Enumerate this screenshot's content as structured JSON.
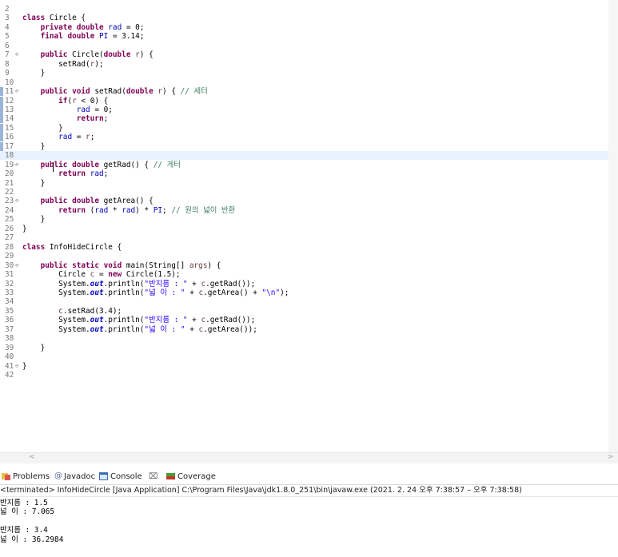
{
  "editor": {
    "lines": [
      {
        "n": "2",
        "parts": []
      },
      {
        "n": "3",
        "parts": [
          {
            "t": "class",
            "c": "kw"
          },
          {
            "t": " Circle {"
          }
        ]
      },
      {
        "n": "4",
        "parts": [
          {
            "t": "    "
          },
          {
            "t": "private",
            "c": "kw"
          },
          {
            "t": " "
          },
          {
            "t": "double",
            "c": "kw"
          },
          {
            "t": " "
          },
          {
            "t": "rad",
            "c": "fld"
          },
          {
            "t": " = 0;"
          }
        ]
      },
      {
        "n": "5",
        "parts": [
          {
            "t": "    "
          },
          {
            "t": "final",
            "c": "kw"
          },
          {
            "t": " "
          },
          {
            "t": "double",
            "c": "kw"
          },
          {
            "t": " "
          },
          {
            "t": "PI",
            "c": "fld"
          },
          {
            "t": " = 3.14;"
          }
        ]
      },
      {
        "n": "6",
        "parts": []
      },
      {
        "n": "7",
        "fold": true,
        "parts": [
          {
            "t": "    "
          },
          {
            "t": "public",
            "c": "kw"
          },
          {
            "t": " Circle("
          },
          {
            "t": "double",
            "c": "kw"
          },
          {
            "t": " "
          },
          {
            "t": "r",
            "c": "prm"
          },
          {
            "t": ") {"
          }
        ]
      },
      {
        "n": "8",
        "parts": [
          {
            "t": "        setRad("
          },
          {
            "t": "r",
            "c": "prm"
          },
          {
            "t": ");"
          }
        ]
      },
      {
        "n": "9",
        "parts": [
          {
            "t": "    }"
          }
        ]
      },
      {
        "n": "10",
        "parts": []
      },
      {
        "n": "11",
        "fold": true,
        "mark": true,
        "parts": [
          {
            "t": "    "
          },
          {
            "t": "public",
            "c": "kw"
          },
          {
            "t": " "
          },
          {
            "t": "void",
            "c": "kw"
          },
          {
            "t": " setRad("
          },
          {
            "t": "double",
            "c": "kw"
          },
          {
            "t": " "
          },
          {
            "t": "r",
            "c": "prm"
          },
          {
            "t": ") { "
          },
          {
            "t": "// 세터",
            "c": "cmt"
          }
        ]
      },
      {
        "n": "12",
        "mark": true,
        "parts": [
          {
            "t": "        "
          },
          {
            "t": "if",
            "c": "kw"
          },
          {
            "t": "("
          },
          {
            "t": "r",
            "c": "prm"
          },
          {
            "t": " < 0) {"
          }
        ]
      },
      {
        "n": "13",
        "mark": true,
        "parts": [
          {
            "t": "            "
          },
          {
            "t": "rad",
            "c": "fld"
          },
          {
            "t": " = 0;"
          }
        ]
      },
      {
        "n": "14",
        "mark": true,
        "parts": [
          {
            "t": "            "
          },
          {
            "t": "return",
            "c": "kw"
          },
          {
            "t": ";"
          }
        ]
      },
      {
        "n": "15",
        "mark": true,
        "parts": [
          {
            "t": "        }"
          }
        ]
      },
      {
        "n": "16",
        "mark": true,
        "parts": [
          {
            "t": "        "
          },
          {
            "t": "rad",
            "c": "fld"
          },
          {
            "t": " = "
          },
          {
            "t": "r",
            "c": "prm"
          },
          {
            "t": ";"
          }
        ]
      },
      {
        "n": "17",
        "mark": true,
        "parts": [
          {
            "t": "    }"
          }
        ]
      },
      {
        "n": "18",
        "current": true,
        "parts": []
      },
      {
        "n": "19",
        "fold": true,
        "parts": [
          {
            "t": "    "
          },
          {
            "t": "public",
            "c": "kw"
          },
          {
            "t": " "
          },
          {
            "t": "double",
            "c": "kw"
          },
          {
            "t": " getRad() { "
          },
          {
            "t": "// 게터",
            "c": "cmt"
          }
        ]
      },
      {
        "n": "20",
        "parts": [
          {
            "t": "        "
          },
          {
            "t": "return",
            "c": "kw"
          },
          {
            "t": " "
          },
          {
            "t": "rad",
            "c": "fld"
          },
          {
            "t": ";"
          }
        ]
      },
      {
        "n": "21",
        "parts": [
          {
            "t": "    }"
          }
        ]
      },
      {
        "n": "22",
        "parts": []
      },
      {
        "n": "23",
        "fold": true,
        "parts": [
          {
            "t": "    "
          },
          {
            "t": "public",
            "c": "kw"
          },
          {
            "t": " "
          },
          {
            "t": "double",
            "c": "kw"
          },
          {
            "t": " getArea() {"
          }
        ]
      },
      {
        "n": "24",
        "parts": [
          {
            "t": "        "
          },
          {
            "t": "return",
            "c": "kw"
          },
          {
            "t": " ("
          },
          {
            "t": "rad",
            "c": "fld"
          },
          {
            "t": " * "
          },
          {
            "t": "rad",
            "c": "fld"
          },
          {
            "t": ") * "
          },
          {
            "t": "PI",
            "c": "fld"
          },
          {
            "t": "; "
          },
          {
            "t": "// 원의 넓이 반환",
            "c": "cmt"
          }
        ]
      },
      {
        "n": "25",
        "parts": [
          {
            "t": "    }"
          }
        ]
      },
      {
        "n": "26",
        "parts": [
          {
            "t": "}"
          }
        ]
      },
      {
        "n": "27",
        "parts": []
      },
      {
        "n": "28",
        "parts": [
          {
            "t": "class",
            "c": "kw"
          },
          {
            "t": " InfoHideCircle {"
          }
        ]
      },
      {
        "n": "29",
        "parts": []
      },
      {
        "n": "30",
        "fold": true,
        "parts": [
          {
            "t": "    "
          },
          {
            "t": "public",
            "c": "kw"
          },
          {
            "t": " "
          },
          {
            "t": "static",
            "c": "kw"
          },
          {
            "t": " "
          },
          {
            "t": "void",
            "c": "kw"
          },
          {
            "t": " main(String[] "
          },
          {
            "t": "args",
            "c": "prm"
          },
          {
            "t": ") {"
          }
        ]
      },
      {
        "n": "31",
        "parts": [
          {
            "t": "        Circle "
          },
          {
            "t": "c",
            "c": "prm"
          },
          {
            "t": " = "
          },
          {
            "t": "new",
            "c": "kw"
          },
          {
            "t": " Circle(1.5);"
          }
        ]
      },
      {
        "n": "32",
        "parts": [
          {
            "t": "        System."
          },
          {
            "t": "out",
            "c": "sfld"
          },
          {
            "t": ".println("
          },
          {
            "t": "\"반지름 : \"",
            "c": "str"
          },
          {
            "t": " + "
          },
          {
            "t": "c",
            "c": "prm"
          },
          {
            "t": ".getRad());"
          }
        ]
      },
      {
        "n": "33",
        "parts": [
          {
            "t": "        System."
          },
          {
            "t": "out",
            "c": "sfld"
          },
          {
            "t": ".println("
          },
          {
            "t": "\"넓 이 : \"",
            "c": "str"
          },
          {
            "t": " + "
          },
          {
            "t": "c",
            "c": "prm"
          },
          {
            "t": ".getArea() + "
          },
          {
            "t": "\"\\n\"",
            "c": "str"
          },
          {
            "t": ");"
          }
        ]
      },
      {
        "n": "34",
        "parts": []
      },
      {
        "n": "35",
        "parts": [
          {
            "t": "        "
          },
          {
            "t": "c",
            "c": "prm"
          },
          {
            "t": ".setRad(3.4);"
          }
        ]
      },
      {
        "n": "36",
        "parts": [
          {
            "t": "        System."
          },
          {
            "t": "out",
            "c": "sfld"
          },
          {
            "t": ".println("
          },
          {
            "t": "\"반지름 : \"",
            "c": "str"
          },
          {
            "t": " + "
          },
          {
            "t": "c",
            "c": "prm"
          },
          {
            "t": ".getRad());"
          }
        ]
      },
      {
        "n": "37",
        "parts": [
          {
            "t": "        System."
          },
          {
            "t": "out",
            "c": "sfld"
          },
          {
            "t": ".println("
          },
          {
            "t": "\"넓 이 : \"",
            "c": "str"
          },
          {
            "t": " + "
          },
          {
            "t": "c",
            "c": "prm"
          },
          {
            "t": ".getArea());"
          }
        ]
      },
      {
        "n": "38",
        "parts": []
      },
      {
        "n": "39",
        "parts": [
          {
            "t": "    }"
          }
        ]
      },
      {
        "n": "40",
        "parts": []
      },
      {
        "n": "41",
        "fold": true,
        "parts": [
          {
            "t": "}"
          }
        ]
      },
      {
        "n": "42",
        "parts": []
      }
    ]
  },
  "scroll": {
    "left_arrow": "<",
    "right_arrow": ">"
  },
  "views": {
    "tabs": [
      {
        "name": "problems",
        "label": "Problems",
        "icon": "problems-icon",
        "active": false
      },
      {
        "name": "javadoc",
        "label": "Javadoc",
        "icon": "javadoc-at-icon",
        "active": false
      },
      {
        "name": "console",
        "label": "Console",
        "icon": "console-icon",
        "active": true,
        "close": "⌧"
      },
      {
        "name": "coverage",
        "label": "Coverage",
        "icon": "coverage-icon",
        "active": false
      }
    ],
    "status": "<terminated> InfoHideCircle [Java Application] C:\\Program Files\\Java\\jdk1.8.0_251\\bin\\javaw.exe  (2021. 2. 24 오후 7:38:57 – 오후 7:38:58)"
  },
  "console": {
    "lines": [
      "반지름 : 1.5",
      "넓 이 : 7.065",
      "",
      "반지름 : 3.4",
      "넓 이 : 36.2984"
    ]
  },
  "colors": {
    "keyword": "#7f0055",
    "field": "#0000c0",
    "string": "#2a00ff",
    "comment": "#3f7f5f",
    "current_line": "#e8f2fe"
  }
}
